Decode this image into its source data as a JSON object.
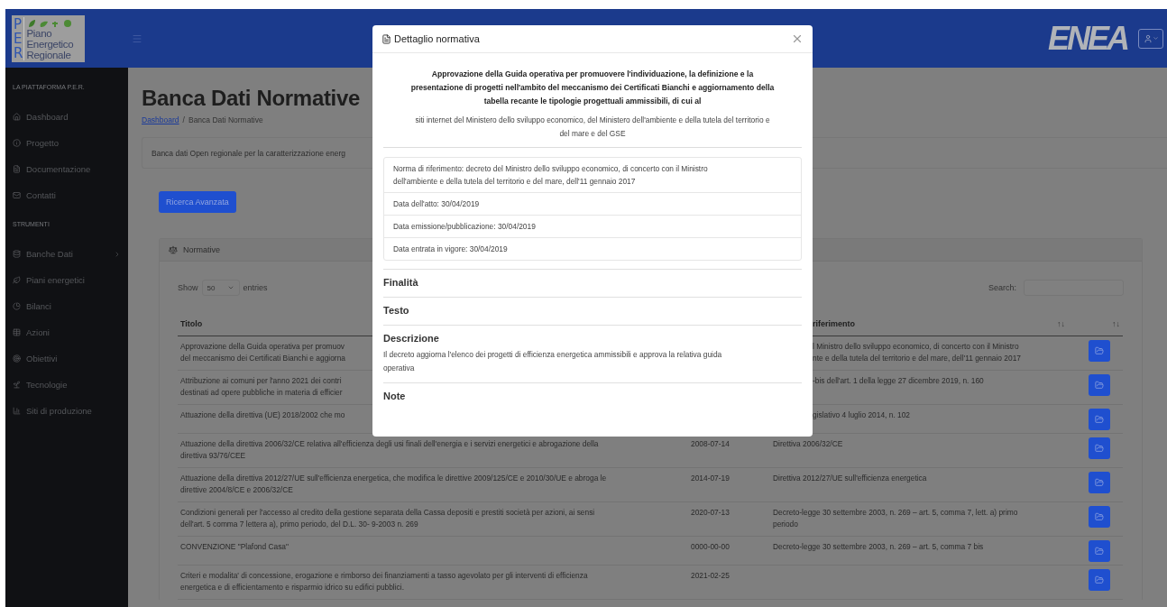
{
  "header": {
    "logo": {
      "letters": [
        "P",
        "E",
        "R"
      ],
      "lines": [
        "Piano",
        "Energetico",
        "Regionale"
      ]
    },
    "brand": "ENEA"
  },
  "sidebar": {
    "sections": [
      {
        "heading": "LA PIATTAFORMA P.E.R.",
        "items": [
          {
            "label": "Dashboard",
            "submenu": false
          },
          {
            "label": "Progetto",
            "submenu": false
          },
          {
            "label": "Documentazione",
            "submenu": false
          },
          {
            "label": "Contatti",
            "submenu": false
          }
        ]
      },
      {
        "heading": "STRUMENTI",
        "items": [
          {
            "label": "Banche Dati",
            "submenu": true
          },
          {
            "label": "Piani energetici",
            "submenu": false
          },
          {
            "label": "Bilanci",
            "submenu": false
          },
          {
            "label": "Azioni",
            "submenu": false
          },
          {
            "label": "Obiettivi",
            "submenu": false
          },
          {
            "label": "Tecnologie",
            "submenu": false
          },
          {
            "label": "Siti di produzione",
            "submenu": false
          }
        ]
      }
    ]
  },
  "page": {
    "title": "Banca Dati Normative",
    "breadcrumb": [
      {
        "label": "Dashboard",
        "link": true
      },
      {
        "label": "/",
        "link": false
      },
      {
        "label": "Banca Dati Normative",
        "link": false
      }
    ],
    "info": "Banca dati Open regionale per la caratterizzazione energ",
    "button": "Ricerca Avanzata"
  },
  "panel": {
    "title": "Normative",
    "show_label": "Show",
    "page_size": "50",
    "entries_label": "entries",
    "search_label": "Search:",
    "columns": {
      "title": {
        "label": "Titolo"
      },
      "reference": {
        "label": "riferimento",
        "sort_icon": "↑↓"
      },
      "actions": {
        "sort_icon": "↑↓"
      }
    },
    "rows": [
      {
        "title": [
          "Approvazione della Guida operativa per promuov",
          "del meccanismo dei Certificati Bianchi e aggiorna"
        ],
        "reference": [
          "l Ministro dello sviluppo economico, di concerto con il Ministro",
          "nte e della tutela del territorio e del mare, dell'11 gennaio 2017"
        ]
      },
      {
        "title": [
          "Attribuzione ai comuni per l'anno 2021 dei contri",
          "destinati ad opere pubbliche in materia di efficier"
        ],
        "reference": [
          "-bis dell'art. 1 della legge 27 dicembre 2019, n. 160"
        ]
      },
      {
        "title": [
          "Attuazione della direttiva (UE) 2018/2002 che mo"
        ],
        "reference": [
          "gislativo 4 luglio 2014, n. 102"
        ]
      },
      {
        "title": [
          "Attuazione della direttiva 2006/32/CE relativa all'efficienza degli usi finali dell'energia e i servizi energetici e abrogazione della",
          "direttiva 93/76/CEE"
        ],
        "date": "2008-07-14",
        "reference": [
          "Direttiva 2006/32/CE"
        ]
      },
      {
        "title": [
          "Attuazione della direttiva 2012/27/UE sull'efficienza energetica, che modifica le direttive 2009/125/CE e 2010/30/UE e abroga le",
          "direttive 2004/8/CE e 2006/32/CE"
        ],
        "date": "2014-07-19",
        "reference": [
          "Direttiva 2012/27/UE sull'efficienza energetica"
        ]
      },
      {
        "title": [
          "Condizioni generali per l'accesso al credito della gestione separata della Cassa depositi e prestiti società per azioni, ai sensi",
          "dell'art. 5 comma 7 lettera a), primo periodo, del D.L. 30- 9-2003 n. 269"
        ],
        "date": "2020-07-13",
        "reference": [
          "Decreto-legge 30 settembre 2003, n. 269 – art. 5, comma 7, lett. a) primo",
          "periodo"
        ]
      },
      {
        "title": [
          "CONVENZIONE \"Plafond Casa\""
        ],
        "date": "0000-00-00",
        "reference": [
          "Decreto-legge 30 settembre 2003, n. 269 – art. 5, comma 7 bis"
        ]
      },
      {
        "title": [
          "Criteri e modalita' di concessione, erogazione e rimborso dei finanziamenti a tasso agevolato per gli interventi di efficienza",
          "energetica e di efficientamento e risparmio idrico su edifici pubblici."
        ],
        "date": "2021-02-25"
      }
    ]
  },
  "modal": {
    "title": "Dettaglio normativa",
    "heading": [
      "Approvazione della Guida operativa per promuovere l'individuazione, la definizione e la",
      "presentazione di progetti nell'ambito del meccanismo dei Certificati Bianchi e aggiornamento della",
      "tabella recante le tipologie progettuali ammissibili, di cui al"
    ],
    "subtitle": [
      "siti internet del Ministero dello sviluppo economico, del Ministero dell'ambiente e della tutela del territorio e",
      "del mare e del GSE"
    ],
    "details": [
      [
        "Norma di riferimento: decreto del Ministro dello sviluppo economico, di concerto con il Ministro",
        "dell'ambiente e della tutela del territorio e del mare, dell'11 gennaio 2017"
      ],
      [
        "Data dell'atto: 30/04/2019"
      ],
      [
        "Data emissione/pubblicazione: 30/04/2019"
      ],
      [
        "Data entrata in vigore: 30/04/2019"
      ]
    ],
    "sections": [
      {
        "heading": "Finalità"
      },
      {
        "heading": "Testo"
      },
      {
        "heading": "Descrizione",
        "text": [
          "Il decreto aggiorna l'elenco dei progetti di efficienza energetica ammissibili e approva la relativa guida",
          "operativa"
        ]
      },
      {
        "heading": "Note"
      }
    ]
  }
}
